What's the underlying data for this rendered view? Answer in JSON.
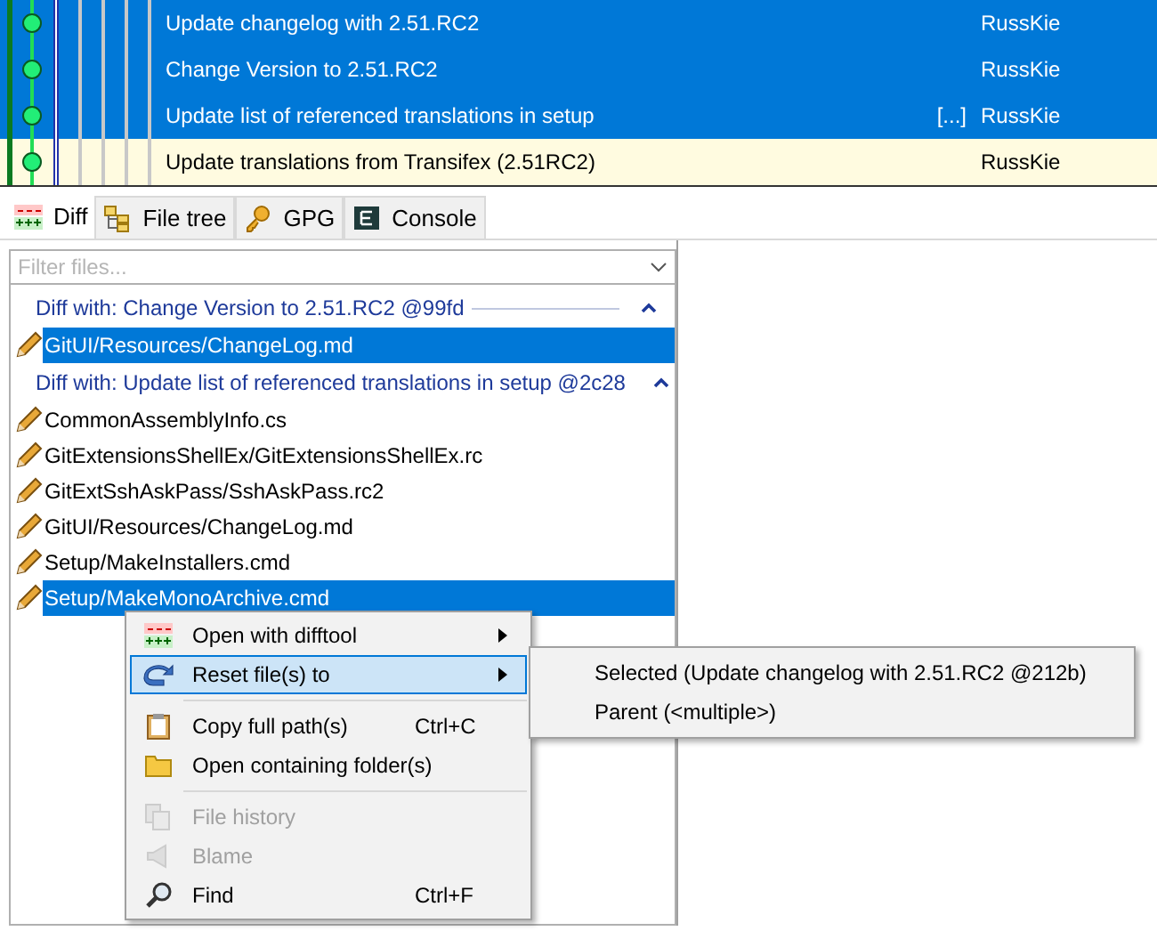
{
  "commits": [
    {
      "message": "Update changelog with 2.51.RC2",
      "author": "RussKie",
      "selected": true
    },
    {
      "message": "Change Version to 2.51.RC2",
      "author": "RussKie",
      "selected": true
    },
    {
      "message": "Update list of referenced translations in setup",
      "more": "[...]",
      "author": "RussKie",
      "selected": true
    },
    {
      "message": "Update translations from Transifex (2.51RC2)",
      "author": "RussKie",
      "selected": false
    }
  ],
  "tabs": [
    {
      "label": "Diff",
      "kind": "diff",
      "selected": true
    },
    {
      "label": "File tree",
      "kind": "tree",
      "selected": false
    },
    {
      "label": "GPG",
      "kind": "key",
      "selected": false
    },
    {
      "label": "Console",
      "kind": "console",
      "selected": false
    }
  ],
  "filter": {
    "placeholder": "Filter files..."
  },
  "groups": [
    {
      "header": "Diff with: Change Version to 2.51.RC2 @99fd",
      "expanded": true,
      "files": [
        {
          "path": "GitUI/Resources/ChangeLog.md",
          "selected": true
        }
      ]
    },
    {
      "header": "Diff with: Update list of referenced translations in setup @2c28",
      "expanded": true,
      "files": [
        {
          "path": "CommonAssemblyInfo.cs",
          "selected": false
        },
        {
          "path": "GitExtensionsShellEx/GitExtensionsShellEx.rc",
          "selected": false
        },
        {
          "path": "GitExtSshAskPass/SshAskPass.rc2",
          "selected": false
        },
        {
          "path": "GitUI/Resources/ChangeLog.md",
          "selected": false
        },
        {
          "path": "Setup/MakeInstallers.cmd",
          "selected": false
        },
        {
          "path": "Setup/MakeMonoArchive.cmd",
          "selected": true
        }
      ]
    }
  ],
  "context_menu": [
    {
      "kind": "item",
      "label": "Open with difftool",
      "submenu": true,
      "highlighted": false,
      "disabled": false
    },
    {
      "kind": "item",
      "label": "Reset file(s) to",
      "submenu": true,
      "highlighted": true,
      "disabled": false
    },
    {
      "kind": "separator"
    },
    {
      "kind": "item",
      "label": "Copy full path(s)",
      "shortcut": "Ctrl+C",
      "submenu": false,
      "highlighted": false,
      "disabled": false
    },
    {
      "kind": "item",
      "label": "Open containing folder(s)",
      "submenu": false,
      "highlighted": false,
      "disabled": false
    },
    {
      "kind": "separator"
    },
    {
      "kind": "item",
      "label": "File history",
      "submenu": false,
      "highlighted": false,
      "disabled": true
    },
    {
      "kind": "item",
      "label": "Blame",
      "submenu": false,
      "highlighted": false,
      "disabled": true
    },
    {
      "kind": "item",
      "label": "Find",
      "shortcut": "Ctrl+F",
      "submenu": false,
      "highlighted": false,
      "disabled": false
    }
  ],
  "submenu": [
    "Selected (Update changelog with 2.51.RC2 @212b)",
    "Parent (<multiple>)"
  ]
}
